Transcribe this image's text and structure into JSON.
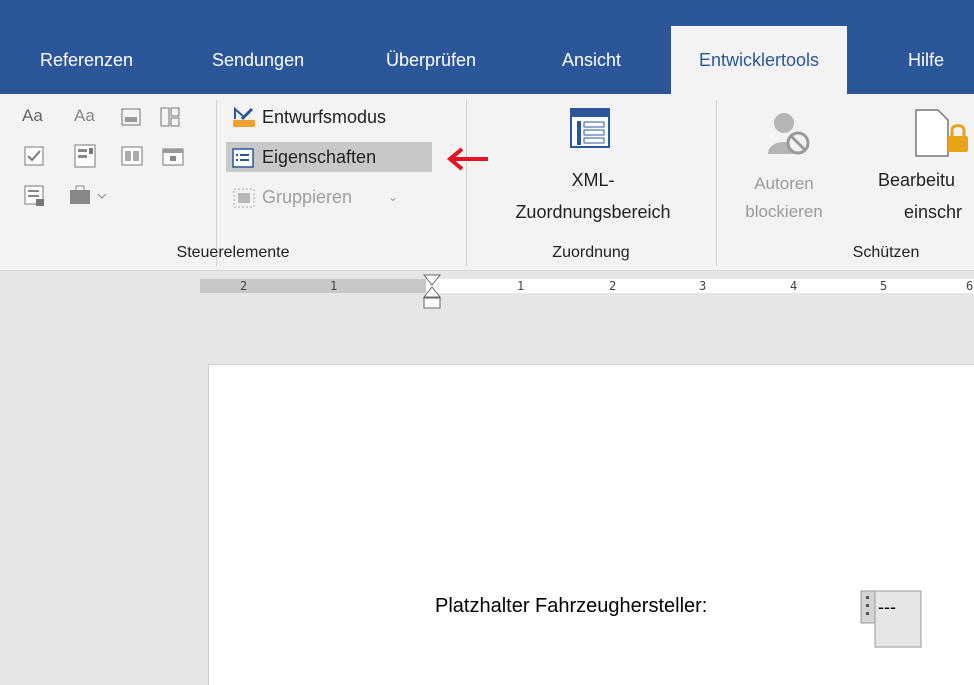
{
  "tabs": [
    {
      "label": "Referenzen"
    },
    {
      "label": "Sendungen"
    },
    {
      "label": "Überprüfen"
    },
    {
      "label": "Ansicht"
    },
    {
      "label": "Entwicklertools"
    },
    {
      "label": "Hilfe"
    }
  ],
  "ribbon": {
    "controls_group": {
      "label": "Steuerelemente",
      "design_mode": "Entwurfsmodus",
      "properties": "Eigenschaften",
      "group": "Gruppieren"
    },
    "mapping_group": {
      "label": "Zuordnung",
      "xml_line1": "XML-",
      "xml_line2": "Zuordnungsbereich"
    },
    "protect_group": {
      "label": "Schützen",
      "block_line1": "Autoren",
      "block_line2": "blockieren",
      "restrict_line1": "Bearbeitu",
      "restrict_line2": "einschr"
    }
  },
  "ruler": {
    "labels": [
      "2",
      "1",
      "1",
      "2",
      "3",
      "4",
      "5",
      "6"
    ]
  },
  "document": {
    "placeholder_text": "Platzhalter Fahrzeughersteller:",
    "control_text": "---"
  },
  "colors": {
    "accent": "#2b579a",
    "ribbon_bg": "#f3f3f3",
    "arrow": "#e81123"
  }
}
